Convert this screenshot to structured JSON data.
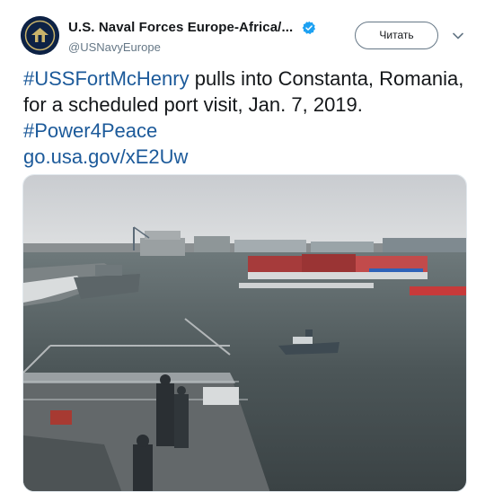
{
  "account": {
    "display_name": "U.S. Naval Forces Europe-Africa/...",
    "handle": "@USNavyEurope",
    "verified_icon": "verified-badge-icon",
    "avatar_icon": "navy-seal-icon"
  },
  "actions": {
    "follow_label": "Читать",
    "menu_icon": "chevron-down-icon"
  },
  "tweet": {
    "hashtag1": "#USSFortMcHenry",
    "text1": " pulls into Constanta, Romania, for a scheduled port visit, Jan. 7, 2019. ",
    "hashtag2": "#Power4Peace",
    "link": "go.usa.gov/xE2Uw"
  },
  "colors": {
    "link": "#1c5a9a",
    "verified": "#1da1f2",
    "text": "#14171a",
    "muted": "#657786"
  }
}
